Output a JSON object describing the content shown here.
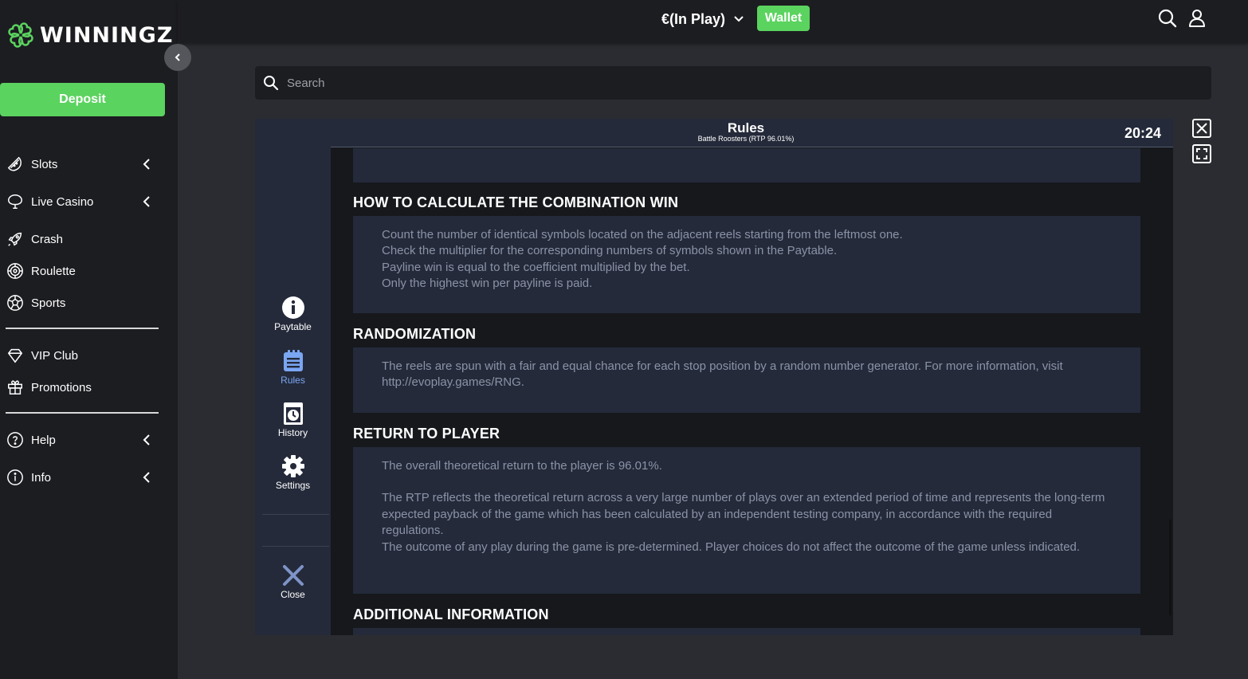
{
  "brand": {
    "name": "WINNINGZ",
    "accent": "#5bd35f"
  },
  "sidebar": {
    "deposit_label": "Deposit",
    "items": [
      {
        "label": "Slots",
        "icon": "watermelon-icon",
        "expandable": true
      },
      {
        "label": "Live Casino",
        "icon": "live-casino-icon",
        "expandable": true
      },
      {
        "label": "Crash",
        "icon": "rocket-icon",
        "expandable": false
      },
      {
        "label": "Roulette",
        "icon": "roulette-icon",
        "expandable": false
      },
      {
        "label": "Sports",
        "icon": "soccer-ball-icon",
        "expandable": false
      },
      {
        "label": "VIP Club",
        "icon": "diamond-icon",
        "expandable": false
      },
      {
        "label": "Promotions",
        "icon": "gift-icon",
        "expandable": false
      },
      {
        "label": "Help",
        "icon": "help-icon",
        "expandable": true
      },
      {
        "label": "Info",
        "icon": "info-icon",
        "expandable": true
      }
    ]
  },
  "header": {
    "balance_label": "€(In Play)",
    "wallet_label": "Wallet"
  },
  "search": {
    "placeholder": "Search"
  },
  "game": {
    "menu": {
      "paytable": "Paytable",
      "rules": "Rules",
      "history": "History",
      "settings": "Settings",
      "close": "Close"
    },
    "rules_title": "Rules",
    "rules_subtitle": "Battle Roosters (RTP 96.01%)",
    "clock": "20:24",
    "sections": {
      "combination": {
        "title": "HOW TO CALCULATE THE COMBINATION WIN",
        "lines": [
          "Count the number of identical symbols located on the adjacent reels starting from the leftmost one.",
          "Check the multiplier for the corresponding numbers of symbols shown in the Paytable.",
          "Payline win is equal to the coefficient multiplied by the bet.",
          "Only the highest win per payline is paid."
        ]
      },
      "randomization": {
        "title": "RANDOMIZATION",
        "text": "The reels are spun with a fair and equal chance for each stop position by a random number generator. For more information, visit http://evoplay.games/RNG."
      },
      "rtp": {
        "title": "RETURN TO PLAYER",
        "line1": "The overall theoretical return to the player is 96.01%.",
        "line2": "The RTP reflects the theoretical return across a very large number of plays over an extended period of time and represents the long-term expected payback of the game which has been calculated by an independent testing company, in accordance with the required regulations.",
        "line3": "The outcome of any play during the game is pre-determined. Player choices do not affect the outcome of the game unless indicated."
      },
      "additional": {
        "title": "ADDITIONAL INFORMATION"
      }
    }
  }
}
